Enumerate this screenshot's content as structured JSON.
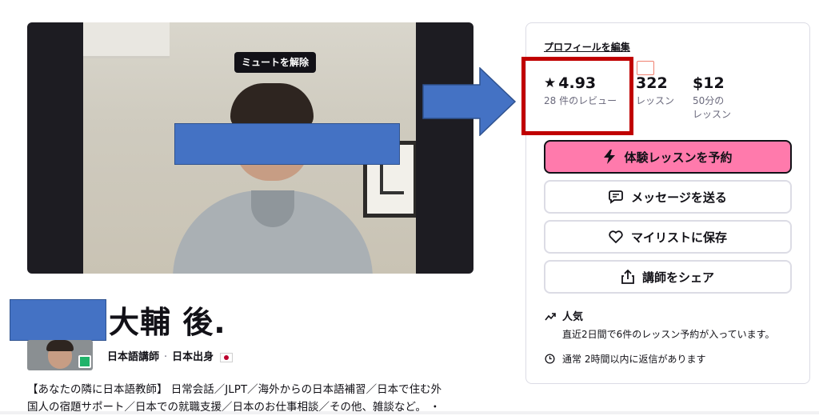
{
  "video": {
    "unmute_label": "ミュートを解除"
  },
  "profile": {
    "name": "大輔 後.",
    "role": "日本語講師",
    "separator": "·",
    "origin": "日本出身",
    "headline_line1": "【あなたの隣に日本語教師】 日常会話／JLPT／海外からの日本語補習／日本で住む外",
    "headline_line2": "国人の宿題サポート／日本での就職支援／日本のお仕事相談／その他、雑談など。 ・"
  },
  "card": {
    "edit_profile_label": "プロフィールを編集",
    "stats": {
      "rating_value": "4.93",
      "rating_label": "28 件のレビュー",
      "lessons_value": "322",
      "lessons_label": "レッスン",
      "price_value": "$12",
      "price_label_line1": "50分の",
      "price_label_line2": "レッスン"
    },
    "buttons": {
      "trial": "体験レッスンを予約",
      "message": "メッセージを送る",
      "save": "マイリストに保存",
      "share": "講師をシェア"
    },
    "popular_title": "人気",
    "popular_desc": "直近2日間で6件のレッスン予約が入っています。",
    "response_text": "通常 2時間以内に返信があります"
  },
  "colors": {
    "trial_button": "#ff7aac",
    "annotation_arrow": "#4472c4",
    "annotation_box": "#c00000",
    "censor_bar": "#4472c4"
  },
  "icons": {
    "star": "star-icon",
    "bolt": "lightning-icon",
    "message": "message-bubble-icon",
    "heart": "heart-icon",
    "share": "share-icon",
    "trend": "trending-up-icon",
    "clock": "clock-icon"
  }
}
